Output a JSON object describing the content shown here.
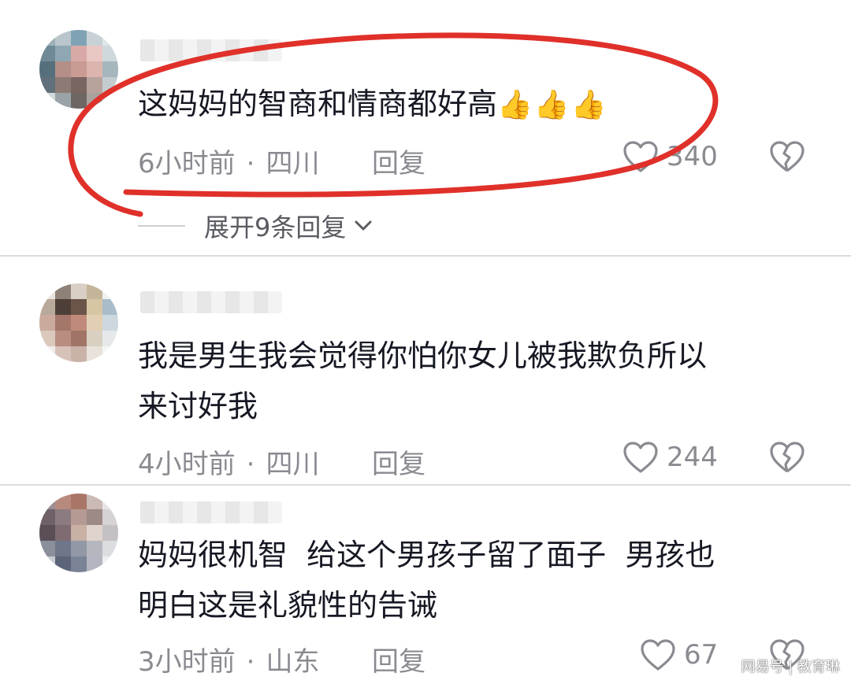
{
  "comments": [
    {
      "text": "这妈妈的智商和情商都好高",
      "emoji": "👍👍👍",
      "time": "6小时前",
      "dot": "·",
      "location": "四川",
      "reply_label": "回复",
      "likes": "340",
      "expand_label": "展开9条回复"
    },
    {
      "text_line1": "我是男生我会觉得你怕你女儿被我欺负所以",
      "text_line2": "来讨好我",
      "time": "4小时前",
      "dot": "·",
      "location": "四川",
      "reply_label": "回复",
      "likes": "244"
    },
    {
      "text_line1": "妈妈很机智  给这个男孩子留了面子  男孩也",
      "text_line2": "明白这是礼貌性的告诫",
      "time": "3小时前",
      "dot": "·",
      "location": "山东",
      "reply_label": "回复",
      "likes": "67"
    }
  ],
  "watermark": "网易号 | 教育琳",
  "colors": {
    "highlight": "#e0302a",
    "meta": "#8a8b91",
    "text": "#161823"
  },
  "icons": [
    "heart-icon",
    "broken-heart-icon",
    "chevron-down-icon"
  ]
}
